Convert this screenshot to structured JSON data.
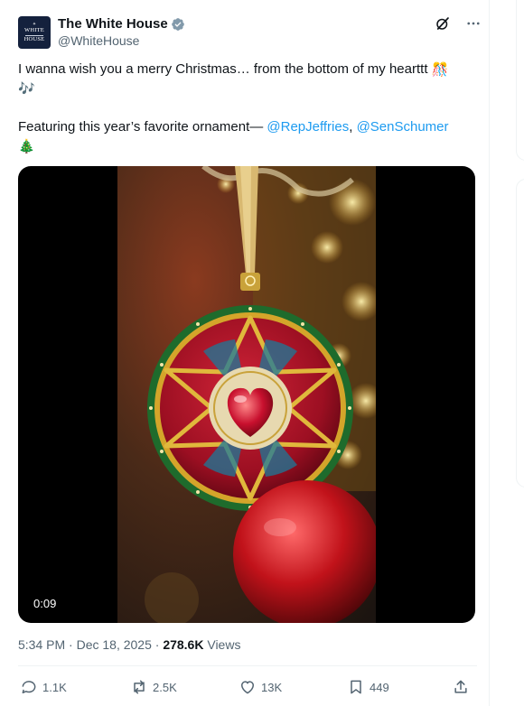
{
  "tweet": {
    "author_name": "The White House",
    "handle": "@WhiteHouse",
    "avatar_line1": "WHITE",
    "avatar_line2": "HOUSE",
    "text_line1": "I wanna wish you a merry Christmas… from the bottom of my hearttt",
    "emoji_1": "🎊",
    "emoji_2": "🎶",
    "text_line2_prefix": "Featuring this year’s favorite ornament— ",
    "mention_1": "@RepJeffries",
    "comma": ", ",
    "mention_2": "@SenSchumer",
    "emoji_3": "🎄",
    "video_duration": "0:09",
    "timestamp": "5:34 PM · Dec 18, 2025 · ",
    "views_count": "278.6K",
    "views_label": " Views"
  },
  "actions": {
    "replies": "1.1K",
    "reposts": "2.5K",
    "likes": "13K",
    "bookmarks": "449"
  },
  "colors": {
    "link": "#1d9bf0",
    "muted": "#536471",
    "verified_badge": "#829aab"
  },
  "icons": [
    "verified-badge-icon",
    "grok-icon",
    "more-icon",
    "reply-icon",
    "repost-icon",
    "like-icon",
    "bookmark-icon",
    "share-icon"
  ]
}
